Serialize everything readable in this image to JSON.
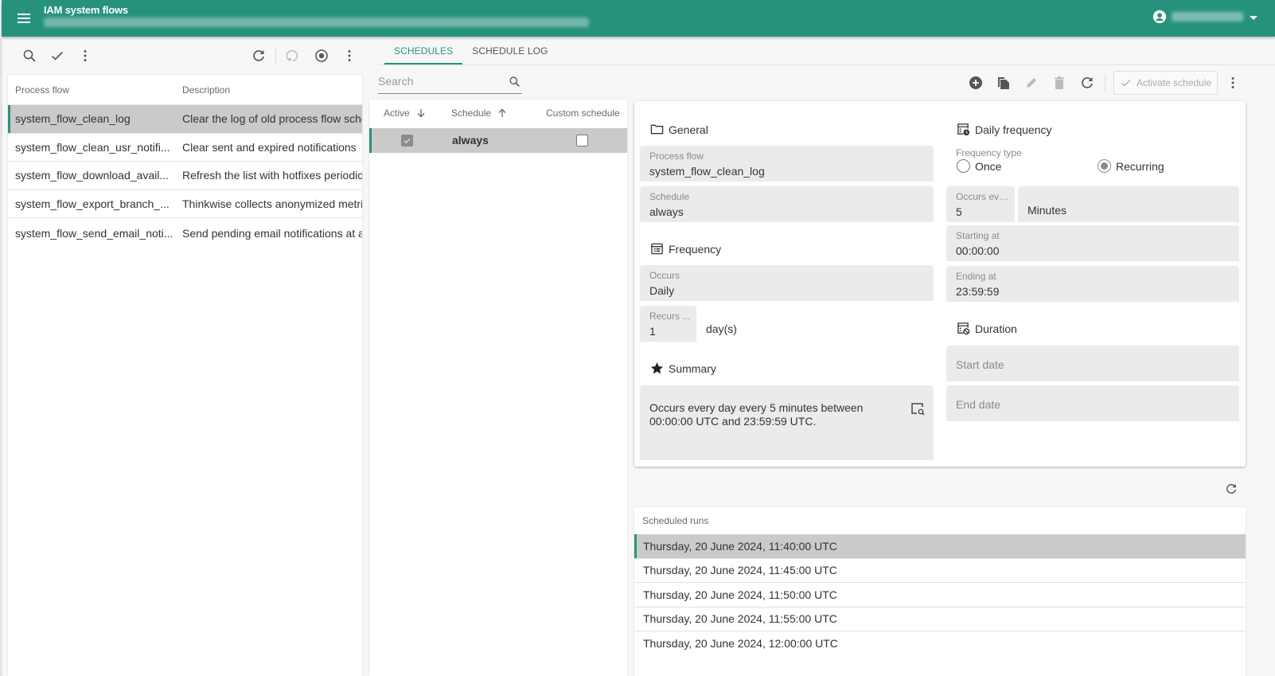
{
  "appbar": {
    "title": "IAM system flows",
    "accent_color": "#27927c"
  },
  "left_panel": {
    "columns": [
      "Process flow",
      "Description"
    ],
    "rows": [
      {
        "process_flow": "system_flow_clean_log",
        "description": "Clear the log of old process flow sche",
        "selected": true
      },
      {
        "process_flow": "system_flow_clean_usr_notifi...",
        "description": "Clear sent and expired notifications",
        "selected": false
      },
      {
        "process_flow": "system_flow_download_avail...",
        "description": "Refresh the list with hotfixes periodic",
        "selected": false
      },
      {
        "process_flow": "system_flow_export_branch_...",
        "description": "Thinkwise collects anonymized metri",
        "selected": false
      },
      {
        "process_flow": "system_flow_send_email_noti...",
        "description": "Send pending email notifications at a",
        "selected": false
      }
    ]
  },
  "tabs": [
    {
      "label": "SCHEDULES",
      "active": true
    },
    {
      "label": "SCHEDULE LOG",
      "active": false
    }
  ],
  "schedules": {
    "search_placeholder": "Search",
    "search_value": "",
    "columns": {
      "active": "Active",
      "schedule": "Schedule",
      "custom": "Custom schedule"
    },
    "rows": [
      {
        "active": true,
        "schedule": "always",
        "custom": false
      }
    ]
  },
  "toolbar": {
    "activate_label": "Activate schedule"
  },
  "form": {
    "general": {
      "title": "General",
      "process_flow_label": "Process flow",
      "process_flow_value": "system_flow_clean_log",
      "schedule_label": "Schedule",
      "schedule_value": "always"
    },
    "frequency": {
      "title": "Frequency",
      "occurs_label": "Occurs",
      "occurs_value": "Daily",
      "recurs_label": "Recurs ...",
      "recurs_value": "1",
      "recurs_unit": "day(s)"
    },
    "summary": {
      "title": "Summary",
      "text": "Occurs every day every 5 minutes between 00:00:00 UTC and 23:59:59 UTC."
    },
    "daily_frequency": {
      "title": "Daily frequency",
      "type_label": "Frequency type",
      "options": [
        "Once",
        "Recurring"
      ],
      "selected": "Recurring",
      "occurs_every_label": "Occurs eve...",
      "occurs_every_value": "5",
      "unit_value": "Minutes",
      "starting_label": "Starting at",
      "starting_value": "00:00:00",
      "ending_label": "Ending at",
      "ending_value": "23:59:59"
    },
    "duration": {
      "title": "Duration",
      "start_placeholder": "Start date",
      "end_placeholder": "End date"
    }
  },
  "scheduled_runs": {
    "header": "Scheduled runs",
    "rows": [
      "Thursday, 20 June 2024, 11:40:00 UTC",
      "Thursday, 20 June 2024, 11:45:00 UTC",
      "Thursday, 20 June 2024, 11:50:00 UTC",
      "Thursday, 20 June 2024, 11:55:00 UTC",
      "Thursday, 20 June 2024, 12:00:00 UTC"
    ]
  }
}
